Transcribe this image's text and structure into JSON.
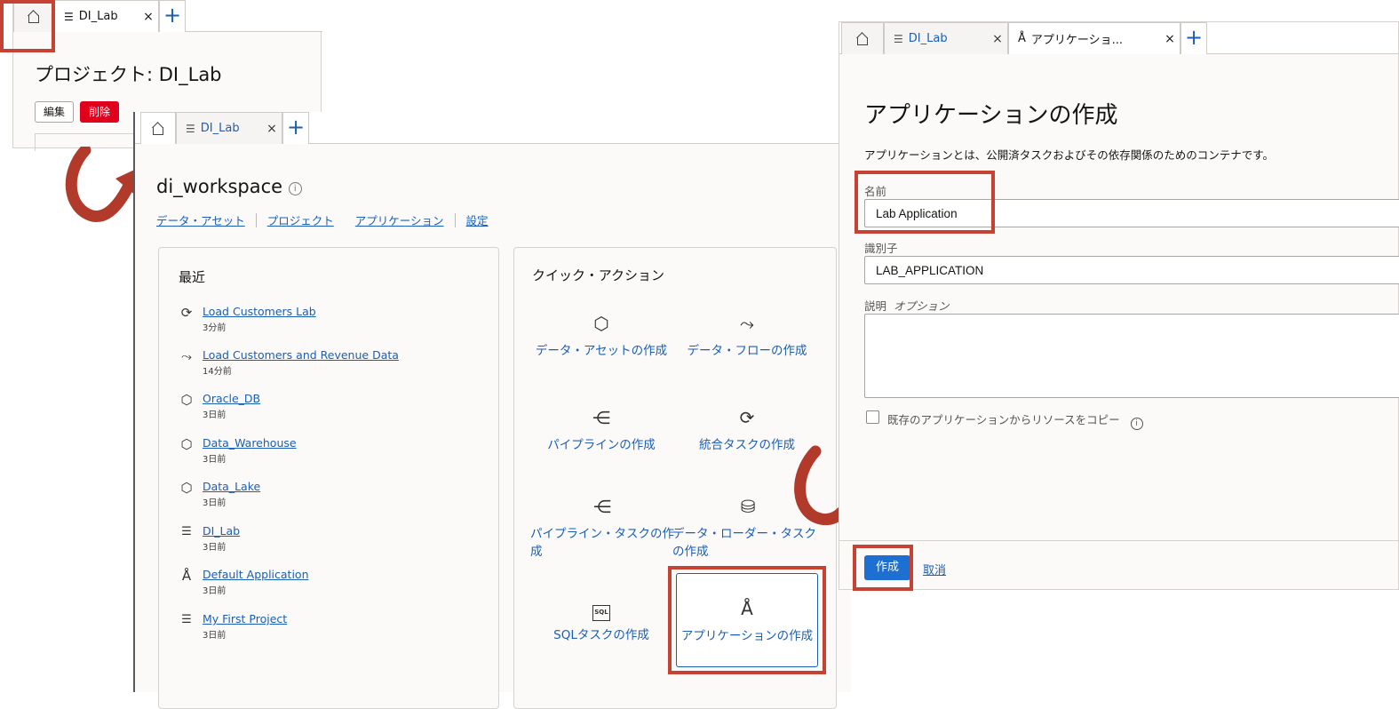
{
  "panel1": {
    "tab": {
      "label": "DI_Lab",
      "close": "×"
    },
    "plus": "+",
    "title": "プロジェクト: DI_Lab",
    "edit_label": "編集",
    "delete_label": "削除"
  },
  "panel2": {
    "tab": {
      "label": "DI_Lab",
      "close": "×"
    },
    "plus": "+",
    "title": "di_workspace",
    "nav": [
      "データ・アセット",
      "プロジェクト",
      "アプリケーション",
      "設定"
    ],
    "recent": {
      "heading": "最近",
      "items": [
        {
          "name": "Load Customers Lab",
          "time": "3分前",
          "icon": "refresh-icon"
        },
        {
          "name": "Load Customers and Revenue Data",
          "time": "14分前",
          "icon": "flow-icon"
        },
        {
          "name": "Oracle_DB",
          "time": "3日前",
          "icon": "cube-icon"
        },
        {
          "name": "Data_Warehouse",
          "time": "3日前",
          "icon": "cube-icon"
        },
        {
          "name": "Data_Lake",
          "time": "3日前",
          "icon": "cube-icon"
        },
        {
          "name": "DI_Lab",
          "time": "3日前",
          "icon": "project-icon"
        },
        {
          "name": "Default Application",
          "time": "3日前",
          "icon": "compass-icon"
        },
        {
          "name": "My First Project",
          "time": "3日前",
          "icon": "project-icon"
        }
      ]
    },
    "quick": {
      "heading": "クイック・アクション",
      "items": [
        {
          "label": "データ・アセットの作成",
          "icon": "cube-icon"
        },
        {
          "label": "データ・フローの作成",
          "icon": "flow-icon"
        },
        {
          "label": "パイプラインの作成",
          "icon": "pipeline-icon"
        },
        {
          "label": "統合タスクの作成",
          "icon": "refresh-icon"
        },
        {
          "label": "パイプライン・タスクの作成",
          "icon": "pipeline-icon"
        },
        {
          "label": "データ・ローダー・タスクの作成",
          "icon": "database-icon"
        },
        {
          "label": "SQLタスクの作成",
          "icon": "sql-icon"
        },
        {
          "label": "アプリケーションの作成",
          "icon": "compass-icon"
        }
      ]
    }
  },
  "panel3": {
    "tabs": [
      {
        "label": "DI_Lab",
        "close": "×"
      },
      {
        "label": "アプリケーショ...",
        "close": "×"
      }
    ],
    "plus": "+",
    "title": "アプリケーションの作成",
    "description": "アプリケーションとは、公開済タスクおよびその依存関係のためのコンテナです。",
    "name_label": "名前",
    "name_value": "Lab Application",
    "identifier_label": "識別子",
    "identifier_value": "LAB_APPLICATION",
    "desc_label": "説明",
    "desc_optional": "オプション",
    "copy_label": "既存のアプリケーションからリソースをコピー",
    "create_label": "作成",
    "cancel_label": "取消"
  },
  "colors": {
    "highlight": "#c64333",
    "link": "#1a5fb4",
    "primary_button": "#1d6fd1",
    "delete_button": "#e0001b",
    "arrow": "#b23a2a"
  }
}
